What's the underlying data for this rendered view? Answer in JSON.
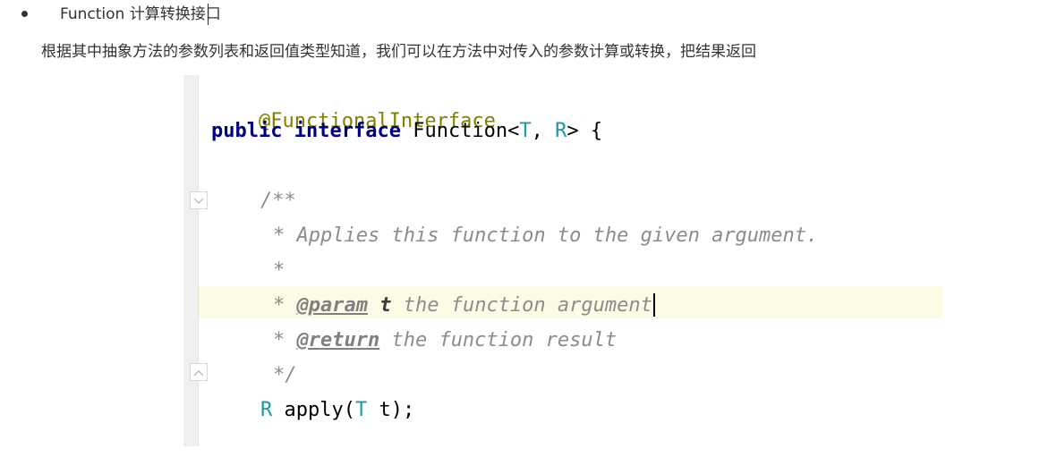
{
  "bullet": {
    "text": "Function 计算转换接口"
  },
  "description": "根据其中抽象方法的参数列表和返回值类型知道，我们可以在方法中对传入的参数计算或转换，把结果返回",
  "code": {
    "annotation": "@FunctionalInterface",
    "kw_public": "public",
    "kw_interface": "interface",
    "class_name": "Function",
    "lt": "<",
    "tparam_t": "T",
    "comma": ", ",
    "tparam_r": "R",
    "gt_brace": "> {",
    "doc_open": "/**",
    "doc_summary": "* Applies this function to the given argument.",
    "doc_blank": "*",
    "doc_star": "* ",
    "doc_param_tag": "@param",
    "doc_param_name": "t",
    "doc_param_desc": " the function argument",
    "doc_return_tag": "@return",
    "doc_return_desc": " the function result",
    "doc_close": "*/",
    "ret_type": "R",
    "method_mid": " apply(",
    "arg_type": "T",
    "method_end": " t);"
  },
  "colors": {
    "annotation": "#808000",
    "keyword": "#000080",
    "type_param": "#20999d",
    "doc_comment": "#8c8c8c",
    "highlight_line": "#fdfbe6"
  }
}
